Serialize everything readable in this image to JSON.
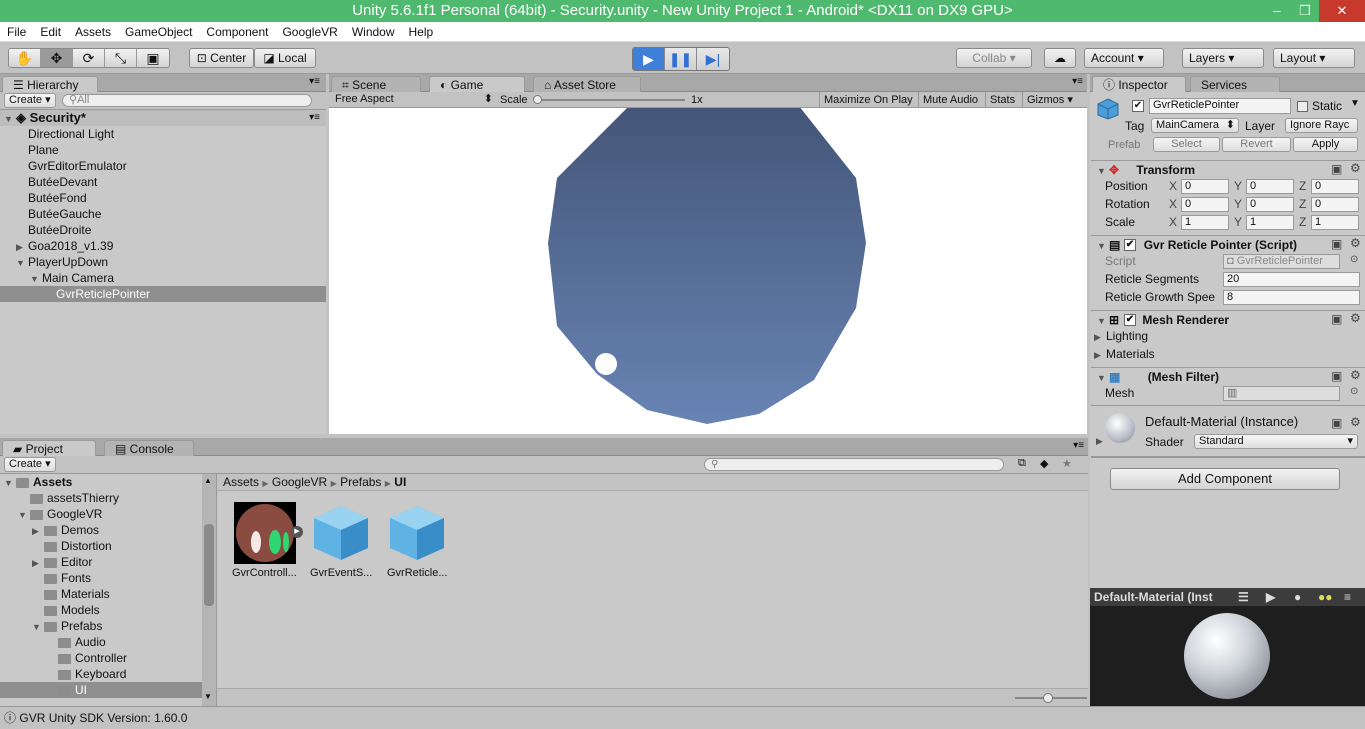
{
  "window": {
    "title": "Unity 5.6.1f1 Personal (64bit) - Security.unity - New Unity Project 1 - Android* <DX11 on DX9 GPU>",
    "min": "–",
    "max": "❐",
    "close": "✕"
  },
  "menu": [
    "File",
    "Edit",
    "Assets",
    "GameObject",
    "Component",
    "GoogleVR",
    "Window",
    "Help"
  ],
  "toolbar": {
    "center": "Center",
    "local": "Local",
    "collab": "Collab",
    "account": "Account",
    "layers": "Layers",
    "layout": "Layout"
  },
  "hierarchy": {
    "tab": "Hierarchy",
    "create": "Create",
    "search_placeholder": "All",
    "scene": "Security*",
    "items": [
      {
        "label": "Directional Light",
        "indent": 0,
        "arrow": ""
      },
      {
        "label": "Plane",
        "indent": 0,
        "arrow": ""
      },
      {
        "label": "GvrEditorEmulator",
        "indent": 0,
        "arrow": ""
      },
      {
        "label": "ButéeDevant",
        "indent": 0,
        "arrow": ""
      },
      {
        "label": "ButéeFond",
        "indent": 0,
        "arrow": ""
      },
      {
        "label": "ButéeGauche",
        "indent": 0,
        "arrow": ""
      },
      {
        "label": "ButéeDroite",
        "indent": 0,
        "arrow": ""
      },
      {
        "label": "Goa2018_v1.39",
        "indent": 0,
        "arrow": "▶"
      },
      {
        "label": "PlayerUpDown",
        "indent": 0,
        "arrow": "▼"
      },
      {
        "label": "Main Camera",
        "indent": 1,
        "arrow": "▼"
      },
      {
        "label": "GvrReticlePointer",
        "indent": 2,
        "arrow": "",
        "selected": true
      }
    ]
  },
  "center_tabs": {
    "scene": "Scene",
    "game": "Game",
    "asset_store": "Asset Store"
  },
  "game_bar": {
    "aspect": "Free Aspect",
    "scale": "Scale",
    "scale_value": "1x",
    "maximize": "Maximize On Play",
    "mute": "Mute Audio",
    "stats": "Stats",
    "gizmos": "Gizmos"
  },
  "inspector": {
    "tab": "Inspector",
    "services": "Services",
    "object_name": "GvrReticlePointer",
    "static": "Static",
    "tag_label": "Tag",
    "tag": "MainCamera",
    "layer_label": "Layer",
    "layer": "Ignore Rayc",
    "prefab": "Prefab",
    "select": "Select",
    "revert": "Revert",
    "apply": "Apply",
    "transform": {
      "title": "Transform",
      "position": "Position",
      "rotation": "Rotation",
      "scale": "Scale",
      "x": "X",
      "y": "Y",
      "z": "Z",
      "pos": [
        "0",
        "0",
        "0"
      ],
      "rot": [
        "0",
        "0",
        "0"
      ],
      "scl": [
        "1",
        "1",
        "1"
      ]
    },
    "script_comp": {
      "title": "Gvr Reticle Pointer (Script)",
      "script_label": "Script",
      "script_value": "GvrReticlePointer",
      "segments_label": "Reticle Segments",
      "segments": "20",
      "growth_label": "Reticle Growth Spee",
      "growth": "8"
    },
    "mesh_renderer": {
      "title": "Mesh Renderer",
      "lighting": "Lighting",
      "materials": "Materials"
    },
    "mesh_filter": {
      "title": "(Mesh Filter)",
      "mesh_label": "Mesh"
    },
    "material": {
      "title": "Default-Material (Instance)",
      "shader_label": "Shader",
      "shader": "Standard"
    },
    "add_component": "Add Component",
    "preview_title": "Default-Material (Inst"
  },
  "project": {
    "tab": "Project",
    "console": "Console",
    "create": "Create",
    "tree_root": "Assets",
    "tree": [
      {
        "label": "assetsThierry",
        "indent": 1,
        "arrow": ""
      },
      {
        "label": "GoogleVR",
        "indent": 1,
        "arrow": "▼"
      },
      {
        "label": "Demos",
        "indent": 2,
        "arrow": "▶"
      },
      {
        "label": "Distortion",
        "indent": 2,
        "arrow": ""
      },
      {
        "label": "Editor",
        "indent": 2,
        "arrow": "▶"
      },
      {
        "label": "Fonts",
        "indent": 2,
        "arrow": ""
      },
      {
        "label": "Materials",
        "indent": 2,
        "arrow": ""
      },
      {
        "label": "Models",
        "indent": 2,
        "arrow": ""
      },
      {
        "label": "Prefabs",
        "indent": 2,
        "arrow": "▼"
      },
      {
        "label": "Audio",
        "indent": 3,
        "arrow": ""
      },
      {
        "label": "Controller",
        "indent": 3,
        "arrow": ""
      },
      {
        "label": "Keyboard",
        "indent": 3,
        "arrow": ""
      },
      {
        "label": "UI",
        "indent": 3,
        "arrow": "",
        "selected": true
      }
    ],
    "breadcrumb": [
      "Assets",
      "GoogleVR",
      "Prefabs",
      "UI"
    ],
    "assets": [
      "GvrControll...",
      "GvrEventS...",
      "GvrReticle..."
    ]
  },
  "status": "GVR Unity SDK Version: 1.60.0",
  "colors": {
    "title_green": "#4fba6f",
    "sphere": "#5a74a0",
    "selection": "#8f8f8f"
  }
}
